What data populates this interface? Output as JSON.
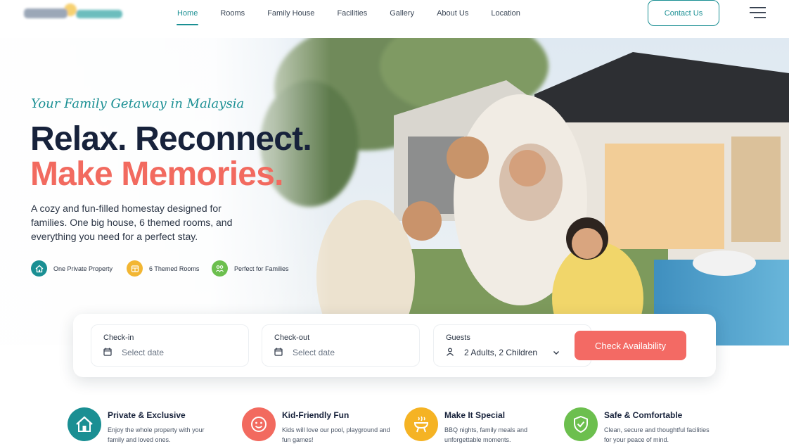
{
  "nav": {
    "items": [
      {
        "label": "Home",
        "active": true
      },
      {
        "label": "Rooms"
      },
      {
        "label": "Family House"
      },
      {
        "label": "Facilities"
      },
      {
        "label": "Gallery"
      },
      {
        "label": "About Us"
      },
      {
        "label": "Location"
      }
    ],
    "contact_label": "Contact Us"
  },
  "hero": {
    "tagline": "Your Family Getaway in Malaysia",
    "headline_line1": "Relax. Reconnect.",
    "headline_line2": "Make Memories.",
    "description": "A cozy and fun-filled homestay designed for families. One big house, 6 themed rooms, and everything you need for a perfect stay.",
    "chips": [
      {
        "label": "One Private Property",
        "icon": "home-icon",
        "color": "#1a8f93"
      },
      {
        "label": "6 Themed Rooms",
        "icon": "rooms-icon",
        "color": "#f2b633"
      },
      {
        "label": "Perfect for Families",
        "icon": "family-icon",
        "color": "#6cbf4e"
      }
    ]
  },
  "booking": {
    "checkin_label": "Check-in",
    "checkin_placeholder": "Select date",
    "checkout_label": "Check-out",
    "checkout_placeholder": "Select date",
    "guests_label": "Guests",
    "guests_value": "2 Adults, 2 Children",
    "button_label": "Check Availability"
  },
  "features": [
    {
      "title": "Private & Exclusive",
      "text": "Enjoy the whole property with your family and loved ones.",
      "icon": "house-icon",
      "color": "#1a8f93"
    },
    {
      "title": "Kid-Friendly Fun",
      "text": "Kids will love our pool, playground and fun games!",
      "icon": "smiley-icon",
      "color": "#f26a5f"
    },
    {
      "title": "Make It Special",
      "text": "BBQ nights, family meals and unforgettable moments.",
      "icon": "bbq-icon",
      "color": "#f5b324"
    },
    {
      "title": "Safe & Comfortable",
      "text": "Clean, secure and thoughtful facilities for your peace of mind.",
      "icon": "shield-icon",
      "color": "#6cbf4e"
    }
  ],
  "colors": {
    "brand_teal": "#1a8f93",
    "accent_coral": "#f36a64",
    "heading_navy": "#17223b"
  }
}
